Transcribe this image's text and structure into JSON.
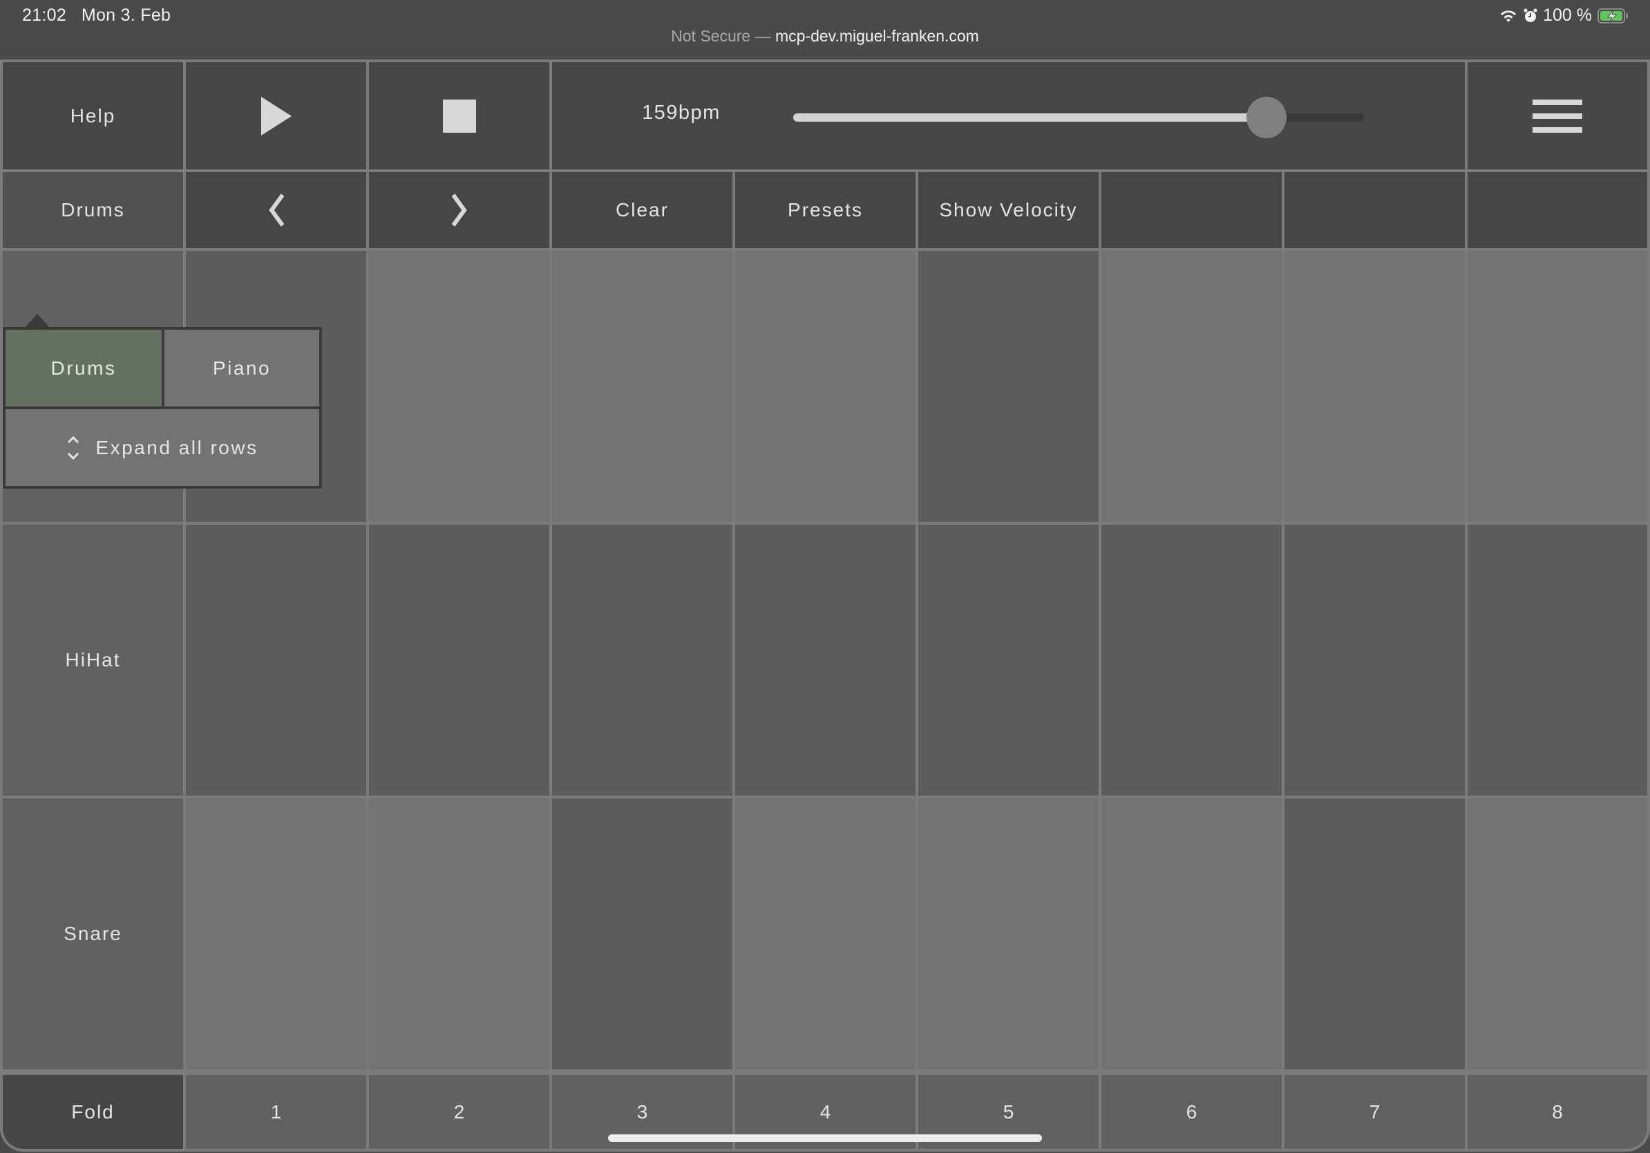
{
  "status_bar": {
    "time": "21:02",
    "date": "Mon 3. Feb",
    "battery_percent": "100 %",
    "icons": [
      "wifi-icon",
      "alarm-icon",
      "battery-charging-icon"
    ],
    "battery_color": "#5fc45a"
  },
  "browser": {
    "security_label": "Not Secure —",
    "host": "mcp-dev.miguel-franken.com"
  },
  "toolbar": {
    "help_label": "Help",
    "play_icon": "play-icon",
    "stop_icon": "stop-icon",
    "tempo_label": "159bpm",
    "tempo_slider_fraction": 0.83,
    "menu_icon": "hamburger-menu-icon"
  },
  "controls": {
    "instrument_label": "Drums",
    "prev_icon": "chevron-left-icon",
    "next_icon": "chevron-right-icon",
    "clear_label": "Clear",
    "presets_label": "Presets",
    "show_velocity_label": "Show Velocity"
  },
  "instrument_popover": {
    "options": [
      {
        "label": "Drums",
        "selected": true
      },
      {
        "label": "Piano",
        "selected": false
      }
    ],
    "expand_label": "Expand all rows",
    "expand_icon": "expand-vertical-icon",
    "selected_color": "#647060"
  },
  "grid": {
    "rows": [
      {
        "label": "",
        "steps": [
          true,
          false,
          false,
          false,
          true,
          false,
          false,
          false
        ]
      },
      {
        "label": "HiHat",
        "steps": [
          true,
          true,
          true,
          true,
          true,
          true,
          true,
          true
        ]
      },
      {
        "label": "Snare",
        "steps": [
          false,
          false,
          true,
          false,
          false,
          false,
          true,
          false
        ]
      }
    ],
    "active_color": "#5d5d5d",
    "inactive_color": "#737373"
  },
  "footer": {
    "fold_label": "Fold",
    "step_numbers": [
      "1",
      "2",
      "3",
      "4",
      "5",
      "6",
      "7",
      "8"
    ]
  }
}
